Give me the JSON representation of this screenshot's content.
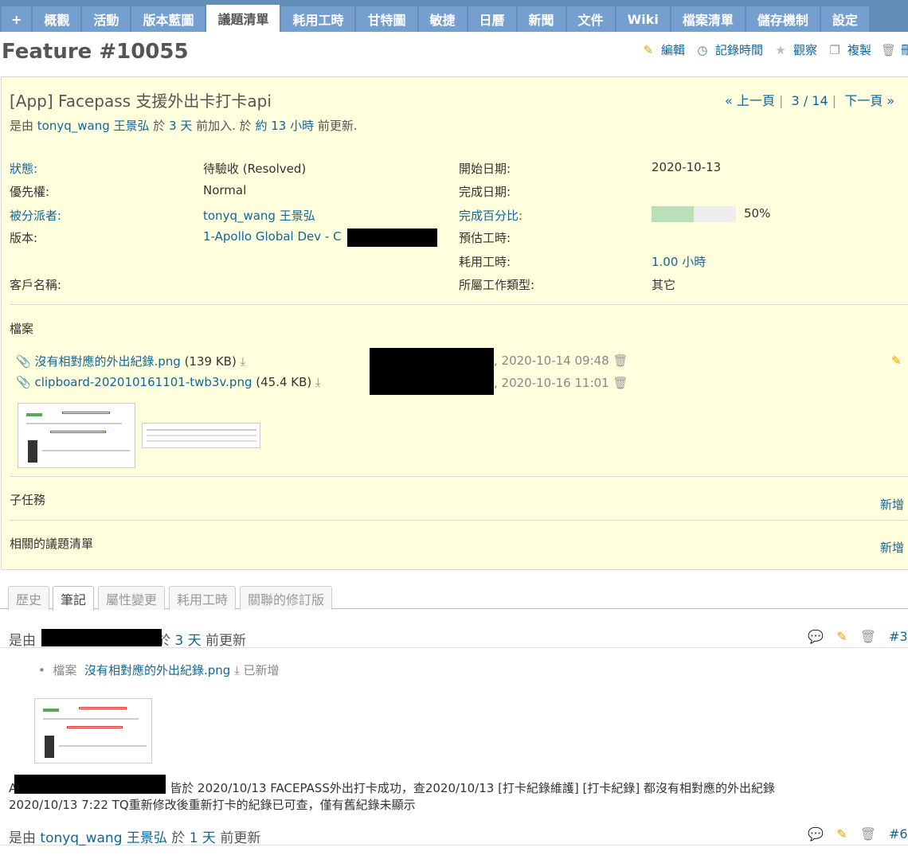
{
  "nav": [
    "+",
    "概觀",
    "活動",
    "版本藍圖",
    "議題清單",
    "耗用工時",
    "甘特圖",
    "敏捷",
    "日曆",
    "新聞",
    "文件",
    "Wiki",
    "檔案清單",
    "儲存機制",
    "設定"
  ],
  "nav_selected": "議題清單",
  "page_title": "Feature #10055",
  "actions": [
    {
      "label": "編輯",
      "icon": "pencil-icon"
    },
    {
      "label": "記錄時間",
      "icon": "clock-icon"
    },
    {
      "label": "觀察",
      "icon": "star-icon"
    },
    {
      "label": "複製",
      "icon": "copy-icon"
    },
    {
      "label": "刪除",
      "icon": "trash-icon"
    }
  ],
  "issue": {
    "subject": "[App] Facepass 支援外出卡打卡api",
    "pager": {
      "prev": "« 上一頁",
      "position": "3 / 14",
      "next": "下一頁 »"
    },
    "author": {
      "prefix": "是由 ",
      "name": "tonyq_wang 王景弘",
      "mid": " 於 ",
      "created": "3 天",
      "mid2": " 前加入. 於 ",
      "updated": "約 13 小時",
      "suffix": " 前更新."
    },
    "attributes": {
      "status": {
        "label": "狀態:",
        "value": "待驗收 (Resolved)"
      },
      "priority": {
        "label": "優先權:",
        "value": "Normal"
      },
      "assignee": {
        "label": "被分派者:",
        "value": "tonyq_wang 王景弘"
      },
      "version": {
        "label": "版本:",
        "value": "1-Apollo Global Dev - C"
      },
      "customer": {
        "label": "客戶名稱:",
        "value": ""
      },
      "start_date": {
        "label": "開始日期:",
        "value": "2020-10-13"
      },
      "due_date": {
        "label": "完成日期:",
        "value": ""
      },
      "done_ratio": {
        "label": "完成百分比:",
        "value": "50%",
        "fraction": 0.5
      },
      "estimated": {
        "label": "預估工時:",
        "value": ""
      },
      "spent": {
        "label": "耗用工時:",
        "value": "1.00",
        "unit": "小時"
      },
      "work_type": {
        "label": "所屬工作類型:",
        "value": "其它"
      }
    },
    "files_title": "檔案",
    "files": [
      {
        "name": "沒有相對應的外出紀錄.png",
        "size": "(139 KB)",
        "date": ", 2020-10-14 09:48"
      },
      {
        "name": "clipboard-202010161101-twb3v.png",
        "size": "(45.4 KB)",
        "date": ", 2020-10-16 11:01"
      }
    ],
    "subtasks": {
      "title": "子任務",
      "add": "新增"
    },
    "relations": {
      "title": "相關的議題清單",
      "add": "新增"
    }
  },
  "tabs": [
    "歷史",
    "筆記",
    "屬性變更",
    "耗用工時",
    "關聯的修訂版"
  ],
  "tab_selected": "筆記",
  "journal": [
    {
      "prefix": "是由",
      "author": "",
      "mid": "於",
      "when": "3 天",
      "suffix": "前更新",
      "num": "#3"
    },
    {
      "prefix": "是由 ",
      "author": "tonyq_wang 王景弘",
      "mid": " 於 ",
      "when": "1 天",
      "suffix": " 前更新",
      "num": "#6"
    }
  ],
  "journal_detail": {
    "label": "檔案",
    "file": "沒有相對應的外出紀錄.png",
    "action": "已新增"
  },
  "note_line1": "A皆於 2020/10/13 FACEPASS外出打卡成功，查2020/10/13 [打卡紀錄維護] [打卡紀錄] 都沒有相對應的外出紀錄",
  "note_line1_start": "A",
  "note_line1_rest": "皆於 2020/10/13 FACEPASS外出打卡成功，查2020/10/13 [打卡紀錄維護] [打卡紀錄] 都沒有相對應的外出紀錄",
  "note_line2": "2020/10/13 7:22 TQ重新修改後重新打卡的紀錄已可查，僅有舊紀錄未顯示"
}
